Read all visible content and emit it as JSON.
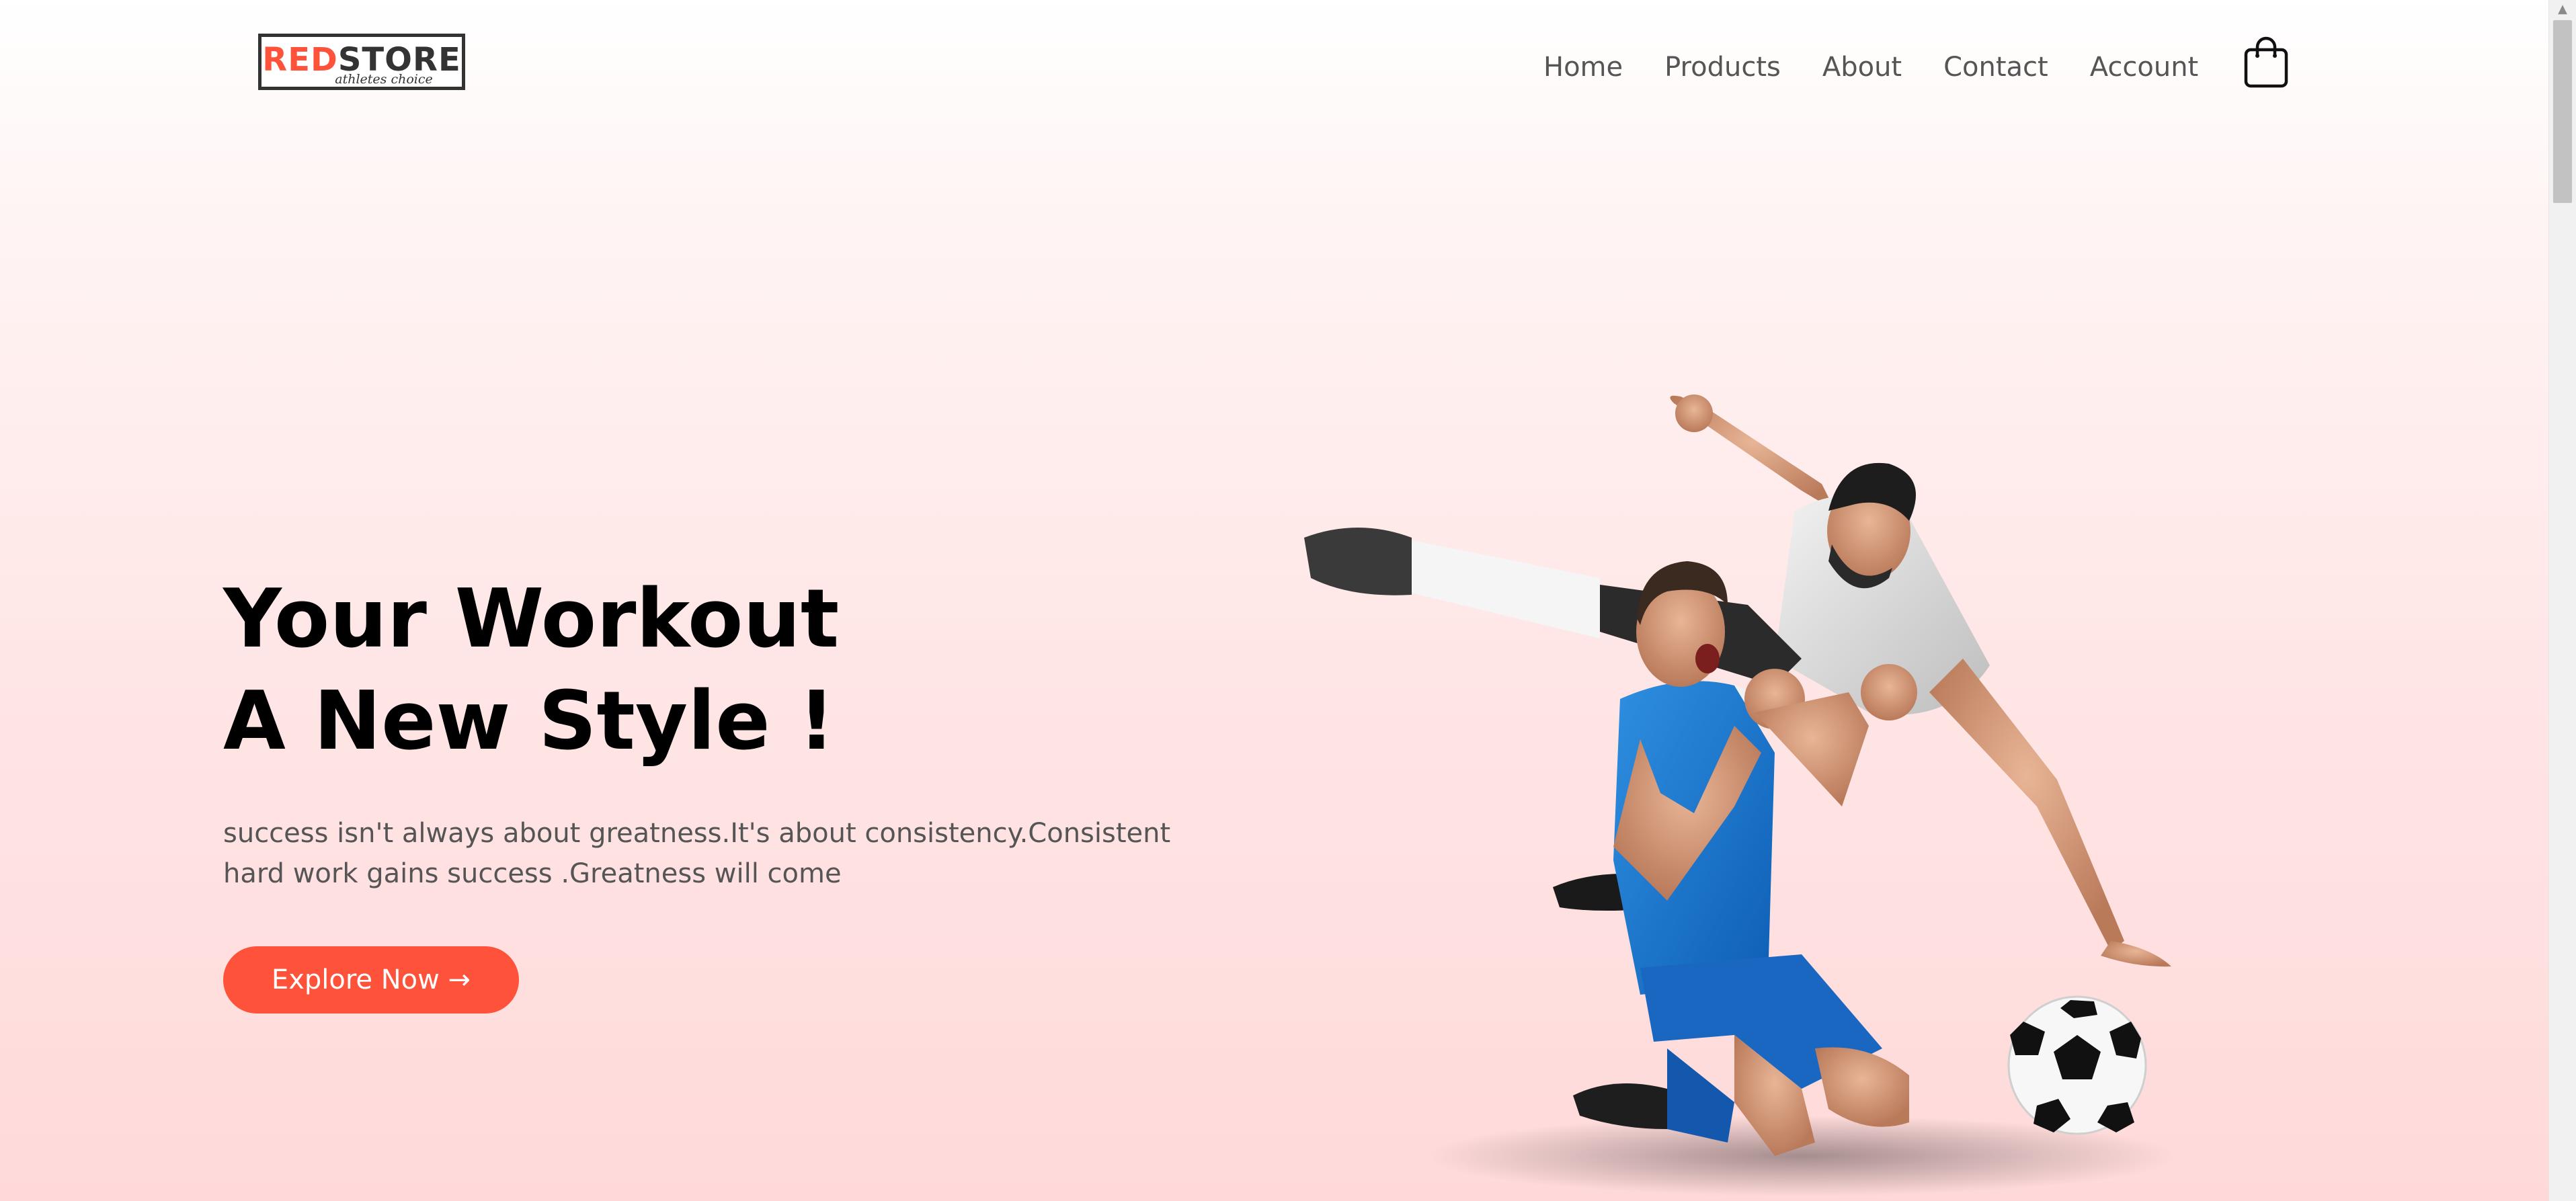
{
  "header": {
    "logo": {
      "text_red": "RED",
      "text_dark": "STORE",
      "tagline": "athletes choice"
    },
    "nav": {
      "items": [
        {
          "label": "Home"
        },
        {
          "label": "Products"
        },
        {
          "label": "About"
        },
        {
          "label": "Contact"
        },
        {
          "label": "Account"
        }
      ],
      "cart_icon": "shopping-bag-icon"
    }
  },
  "hero": {
    "headline_line1": "Your Workout",
    "headline_line2": "A New Style !",
    "tagline": "success isn't always about greatness.It's about consistency.Consistent hard work gains success .Greatness will come",
    "button_label": "Explore Now →",
    "image": "soccer-players-celebrating-illustration"
  },
  "colors": {
    "accent": "#ff523b",
    "text_dark": "#000000",
    "text_muted": "#555555",
    "background_top": "#ffffff",
    "background_bottom": "#ffd9d9"
  }
}
